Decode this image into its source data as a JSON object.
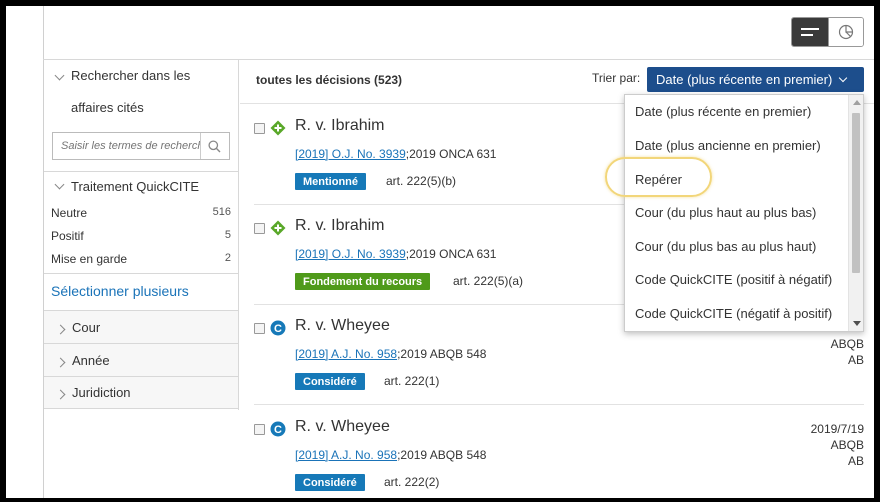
{
  "sidebar": {
    "search_heading": "Rechercher dans les affaires cités",
    "search_placeholder": "Saisir les termes de recherche",
    "treatment_heading": "Traitement QuickCITE",
    "treatments": [
      {
        "label": "Neutre",
        "count": "516"
      },
      {
        "label": "Positif",
        "count": "5"
      },
      {
        "label": "Mise en garde",
        "count": "2"
      }
    ],
    "select_multiple": "Sélectionner plusieurs",
    "facets": [
      "Cour",
      "Année",
      "Juridiction"
    ]
  },
  "results": {
    "heading": "toutes les décisions (523)",
    "sort_label": "Trier par:",
    "sort_value": "Date (plus récente en premier)",
    "items": [
      {
        "title": "R. v. Ibrahim",
        "cite_link": "[2019] O.J. No. 3939",
        "cite_rest": ";2019 ONCA 631",
        "badge": "Mentionné",
        "article": "art. 222(5)(b)",
        "meta": [
          "",
          "",
          ""
        ],
        "icon": "diamond-plus-icon"
      },
      {
        "title": "R. v. Ibrahim",
        "cite_link": "[2019] O.J. No. 3939",
        "cite_rest": ";2019 ONCA 631",
        "badge": "Fondement du recours",
        "article": "art. 222(5)(a)",
        "meta": [
          "",
          "",
          ""
        ],
        "icon": "diamond-plus-icon"
      },
      {
        "title": "R. v. Wheyee",
        "cite_link": "[2019] A.J. No. 958",
        "cite_rest": ";2019 ABQB 548",
        "badge": "Considéré",
        "article": "art. 222(1)",
        "meta": [
          "",
          "ABQB",
          "AB"
        ],
        "icon": "c-circle-icon"
      },
      {
        "title": "R. v. Wheyee",
        "cite_link": "[2019] A.J. No. 958",
        "cite_rest": ";2019 ABQB 548",
        "badge": "Considéré",
        "article": "art. 222(2)",
        "meta": [
          "2019/7/19",
          "ABQB",
          "AB"
        ],
        "icon": "c-circle-icon"
      }
    ]
  },
  "sort_options": [
    "Date (plus récente en premier)",
    "Date (plus ancienne en premier)",
    "Repérer",
    "Cour (du plus haut au plus bas)",
    "Cour (du plus bas au plus haut)",
    "Code QuickCITE (positif à négatif)",
    "Code QuickCITE (négatif à positif)"
  ],
  "colors": {
    "sort_button": "#1d4e8c",
    "badge_mentioned": "#1679b8",
    "badge_foundation": "#4f9a1a",
    "badge_considered": "#1679b8",
    "diamond_icon": "#5aa829",
    "c_icon": "#1679b8",
    "highlight_ring": "#f2d67a"
  }
}
